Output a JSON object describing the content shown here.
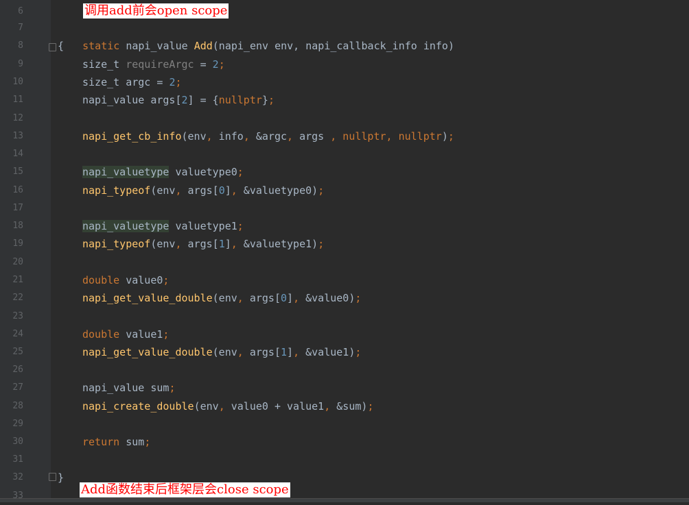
{
  "gutter": {
    "line_numbers": [
      "6",
      "7",
      "8",
      "9",
      "10",
      "11",
      "12",
      "13",
      "14",
      "15",
      "16",
      "17",
      "18",
      "19",
      "20",
      "21",
      "22",
      "23",
      "24",
      "25",
      "26",
      "27",
      "28",
      "29",
      "30",
      "31",
      "32",
      "33"
    ]
  },
  "annotations": {
    "top": "调用add前会open scope",
    "bottom": "Add函数结束后框架层会close scope"
  },
  "code": {
    "l7": {
      "kw": "static",
      "type": " napi_value ",
      "fn": "Add",
      "rest": "(napi_env env, napi_callback_info info)"
    },
    "l8": {
      "brace": "{"
    },
    "l9": {
      "type": "size_t ",
      "muted": "requireArgc",
      "op": " = ",
      "num": "2",
      "semi": ";"
    },
    "l10": {
      "type": "size_t argc = ",
      "num": "2",
      "semi": ";"
    },
    "l11": {
      "a": "napi_value args[",
      "num": "2",
      "b": "] = {",
      "kw": "nullptr",
      "c": "}",
      "semi": ";"
    },
    "l13": {
      "fn": "napi_get_cb_info",
      "a": "(env",
      "p1": ",",
      "b": " info",
      "p2": ",",
      "c": " &argc",
      "p3": ",",
      "d": " args ",
      "p4": ",",
      "kw1": " nullptr",
      "p5": ",",
      "kw2": " nullptr",
      "e": ")",
      "semi": ";"
    },
    "l15": {
      "type": "napi_valuetype",
      "var": " valuetype0",
      "semi": ";"
    },
    "l16": {
      "fn": "napi_typeof",
      "a": "(env",
      "p1": ",",
      "b": " args[",
      "num": "0",
      "c": "]",
      "p2": ",",
      "d": " &valuetype0)",
      "semi": ";"
    },
    "l18": {
      "type": "napi_valuetype",
      "var": " valuetype1",
      "semi": ";"
    },
    "l19": {
      "fn": "napi_typeof",
      "a": "(env",
      "p1": ",",
      "b": " args[",
      "num": "1",
      "c": "]",
      "p2": ",",
      "d": " &valuetype1)",
      "semi": ";"
    },
    "l21": {
      "kw": "double",
      "var": " value0",
      "semi": ";"
    },
    "l22": {
      "fn": "napi_get_value_double",
      "a": "(env",
      "p1": ",",
      "b": " args[",
      "num": "0",
      "c": "]",
      "p2": ",",
      "d": " &value0)",
      "semi": ";"
    },
    "l24": {
      "kw": "double",
      "var": " value1",
      "semi": ";"
    },
    "l25": {
      "fn": "napi_get_value_double",
      "a": "(env",
      "p1": ",",
      "b": " args[",
      "num": "1",
      "c": "]",
      "p2": ",",
      "d": " &value1)",
      "semi": ";"
    },
    "l27": {
      "type": "napi_value sum",
      "semi": ";"
    },
    "l28": {
      "fn": "napi_create_double",
      "a": "(env",
      "p1": ",",
      "b": " value0 + value1",
      "p2": ",",
      "c": " &sum)",
      "semi": ";"
    },
    "l30": {
      "kw": "return",
      "var": " sum",
      "semi": ";"
    },
    "l32": {
      "brace": "}"
    }
  }
}
